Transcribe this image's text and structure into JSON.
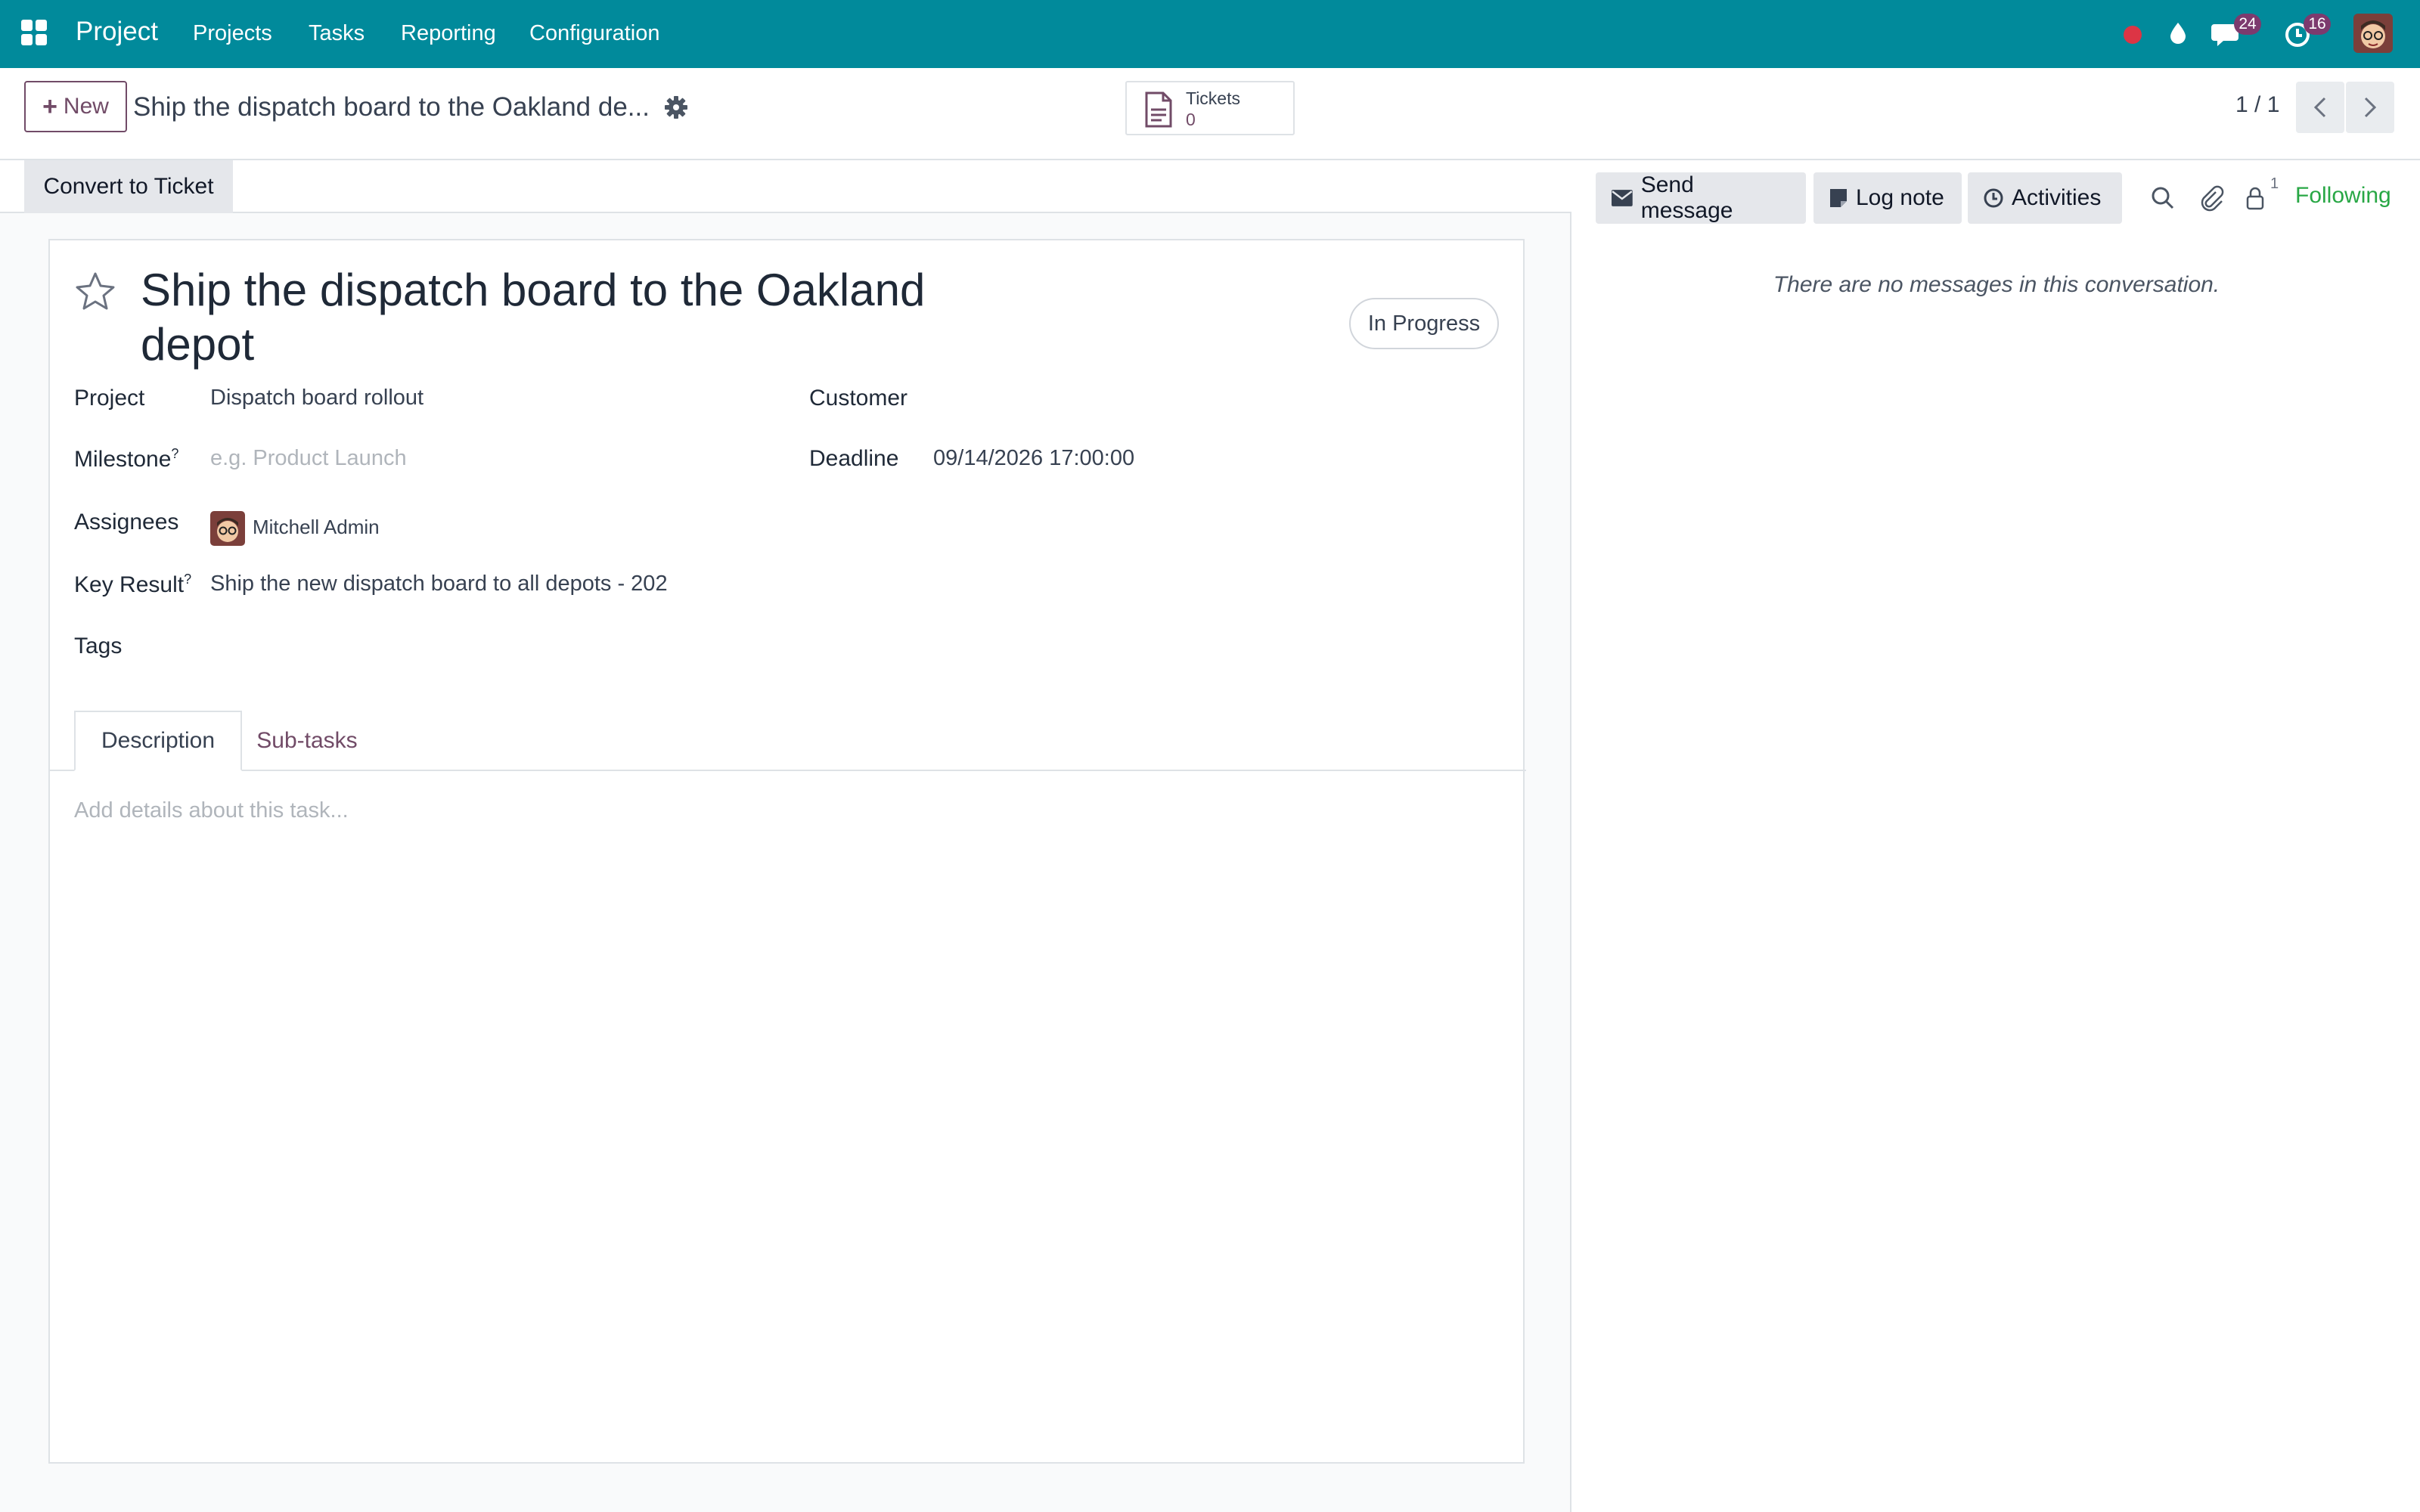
{
  "navbar": {
    "brand": "Project",
    "menu": [
      "Projects",
      "Tasks",
      "Reporting",
      "Configuration"
    ],
    "messages_count": "24",
    "activities_count": "16",
    "colors": {
      "bar": "#018a9b",
      "badge": "#7c3a6e",
      "record_dot": "#dc3545"
    }
  },
  "control_panel": {
    "new_label": "New",
    "record_title": "Ship the dispatch board to the Oakland de...",
    "stat_tickets_label": "Tickets",
    "stat_tickets_value": "0",
    "pager": "1 / 1"
  },
  "statusbar": {
    "convert_label": "Convert to Ticket"
  },
  "task": {
    "title": "Ship the dispatch board to the Oakland depot",
    "state": "In Progress",
    "fields": {
      "project_label": "Project",
      "project_value": "Dispatch board rollout",
      "customer_label": "Customer",
      "milestone_label": "Milestone",
      "milestone_placeholder": "e.g. Product Launch",
      "deadline_label": "Deadline",
      "deadline_value": "09/14/2026 17:00:00",
      "assignees_label": "Assignees",
      "assignee_name": "Mitchell Admin",
      "key_result_label": "Key Result",
      "key_result_value": "Ship the new dispatch board to all depots - 202",
      "tags_label": "Tags",
      "help_mark": "?"
    },
    "tabs": [
      "Description",
      "Sub-tasks"
    ],
    "description_placeholder": "Add details about this task..."
  },
  "chatter": {
    "send_message": "Send message",
    "log_note": "Log note",
    "activities": "Activities",
    "follower_count": "1",
    "following": "Following",
    "empty": "There are no messages in this conversation.",
    "accent_color": "#28a745"
  }
}
